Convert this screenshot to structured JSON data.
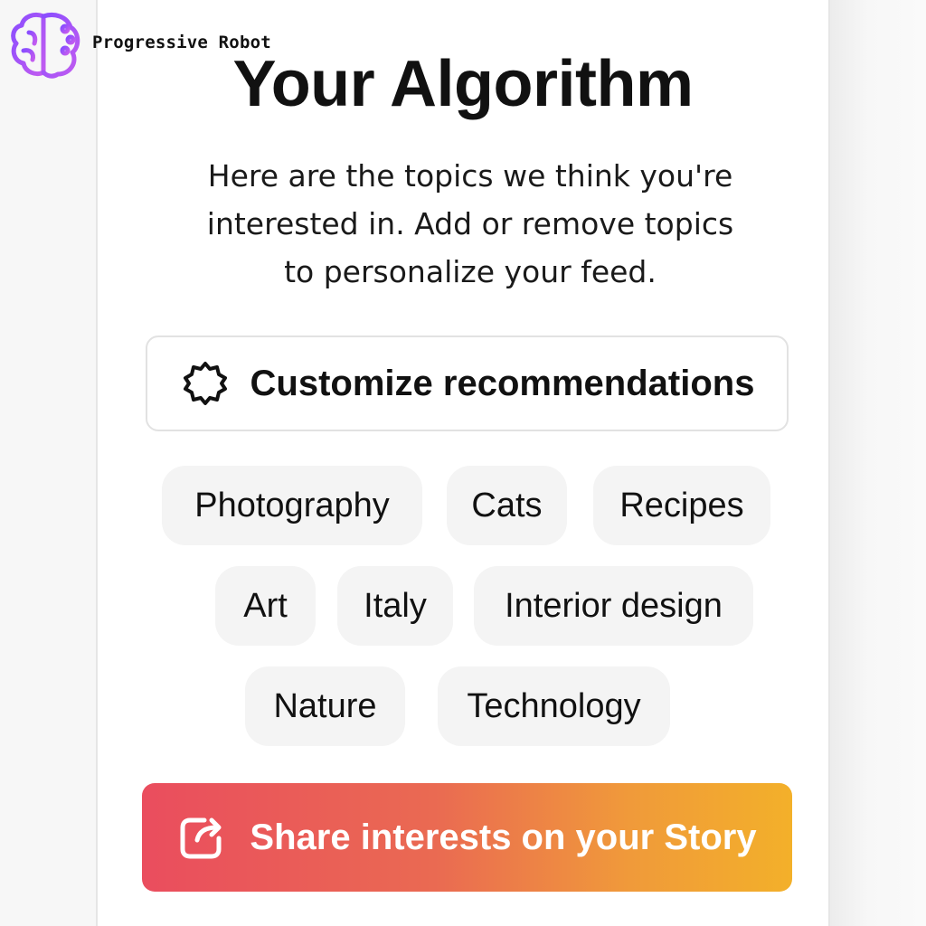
{
  "brand": {
    "name": "Progressive Robot",
    "logo_icon": "brain-circuit-icon",
    "logo_colors": [
      "#8a4dff",
      "#c25cf0"
    ]
  },
  "page": {
    "title": "Your Algorithm",
    "description_lines": [
      "Here are the topics we think you're",
      "interested in. Add or remove topics",
      "to personalize your feed."
    ]
  },
  "customize_button": {
    "icon": "gear-icon",
    "label": "Customize recommendations"
  },
  "topics": [
    "Photography",
    "Cats",
    "Recipes",
    "Art",
    "Italy",
    "Interior design",
    "Nature",
    "Technology"
  ],
  "share_button": {
    "icon": "share-story-icon",
    "label": "Share interests on your Story",
    "gradient": [
      "#ea4d5e",
      "#f3b02a"
    ]
  }
}
